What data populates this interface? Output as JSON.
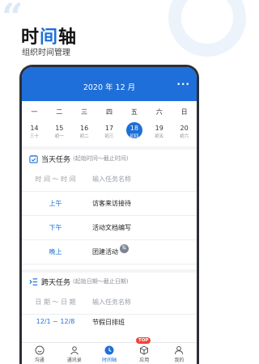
{
  "promo": {
    "title_before": "时",
    "title_highlight": "间",
    "title_after": "轴",
    "subtitle": "组织时间管理"
  },
  "calendar": {
    "month_title": "2020 年 12 月",
    "more_label": "···",
    "weekdays": [
      "一",
      "二",
      "三",
      "四",
      "五",
      "六",
      "日"
    ],
    "dates": [
      {
        "day": "14",
        "lunar": "三十"
      },
      {
        "day": "15",
        "lunar": "初一"
      },
      {
        "day": "16",
        "lunar": "初二"
      },
      {
        "day": "17",
        "lunar": "初三"
      },
      {
        "day": "18",
        "lunar": "初四"
      },
      {
        "day": "19",
        "lunar": "初五"
      },
      {
        "day": "20",
        "lunar": "初六"
      }
    ],
    "selected_day": "18"
  },
  "today_tasks": {
    "title": "当天任务",
    "hint": "(起始时间～截止时间)",
    "header_time": "时 间 ～ 时 间",
    "header_name": "输入任务名称",
    "rows": [
      {
        "time": "上午",
        "name": "访客来访接待",
        "badge": ""
      },
      {
        "time": "下午",
        "name": "活动文档编写",
        "badge": ""
      },
      {
        "time": "晚上",
        "name": "团建活动",
        "badge": "私"
      }
    ]
  },
  "cross_tasks": {
    "title": "跨天任务",
    "hint": "(起始日期～截止日期)",
    "header_date": "日 期 ～ 日 期",
    "header_name": "输入任务名称",
    "partial_row_date": "12/1 ~ 12/8",
    "partial_row_name": "节假日排班"
  },
  "tabbar": {
    "items": [
      "沟通",
      "通讯录",
      "时间轴",
      "应用",
      "我的"
    ],
    "active": "时间轴",
    "badge": "TOP"
  },
  "colors": {
    "accent": "#1e6fd9",
    "badge_red": "#f04438"
  }
}
